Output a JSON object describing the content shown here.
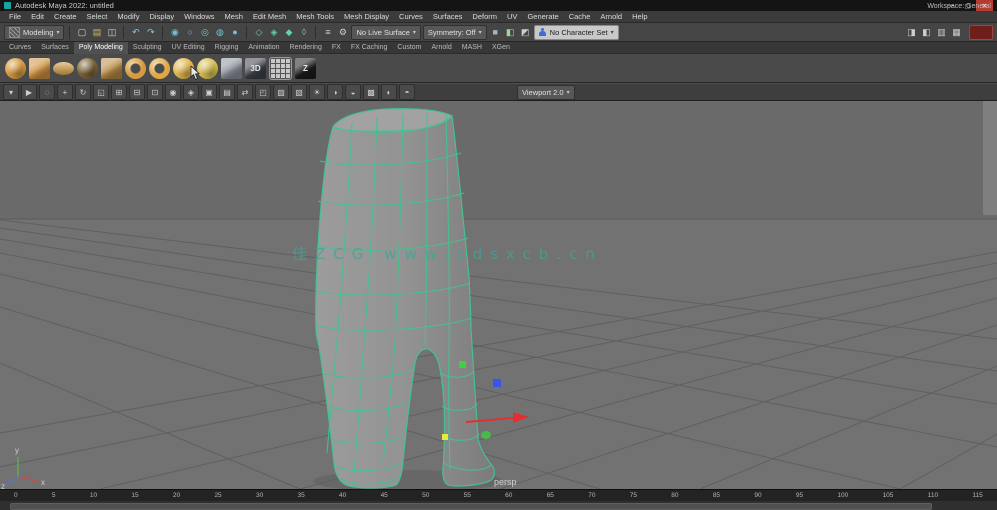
{
  "ui": {
    "caret": "▾"
  },
  "window": {
    "title": "Autodesk Maya 2022: untitled",
    "minimize": "—",
    "maximize": "▢",
    "close": "✕"
  },
  "menubar": {
    "items": [
      "File",
      "Edit",
      "Create",
      "Select",
      "Modify",
      "Display",
      "Windows",
      "Mesh",
      "Edit Mesh",
      "Mesh Tools",
      "Mesh Display",
      "Curves",
      "Surfaces",
      "Deform",
      "UV",
      "Generate",
      "Cache",
      "Arnold",
      "Help"
    ],
    "workspace": "Workspace: General"
  },
  "statusline": {
    "menuset": "Modeling",
    "icons": [
      {
        "type": "sep"
      },
      {
        "name": "new-scene-icon",
        "glyph": "▢",
        "color": "#d8d8d8"
      },
      {
        "name": "open-scene-icon",
        "glyph": "▤",
        "color": "#d8b86a"
      },
      {
        "name": "save-scene-icon",
        "glyph": "◫",
        "color": "#d8d8d8"
      },
      {
        "type": "sep"
      },
      {
        "name": "undo-icon",
        "glyph": "↶",
        "color": "#8fc6e8"
      },
      {
        "name": "redo-icon",
        "glyph": "↷",
        "color": "#8fc6e8"
      },
      {
        "type": "sep"
      },
      {
        "name": "select-hierarchy-icon",
        "glyph": "◉",
        "color": "#6cc6d8"
      },
      {
        "name": "select-object-icon",
        "glyph": "○",
        "color": "#6cc6d8"
      },
      {
        "name": "select-component-icon",
        "glyph": "◎",
        "color": "#6cc6d8"
      },
      {
        "name": "select-highlight-icon",
        "glyph": "◍",
        "color": "#6cc6d8"
      },
      {
        "name": "select-preset-icon",
        "glyph": "●",
        "color": "#6cc6d8"
      },
      {
        "type": "sep"
      },
      {
        "name": "snap-grid-icon",
        "glyph": "◇",
        "color": "#63d0b0"
      },
      {
        "name": "snap-curve-icon",
        "glyph": "◈",
        "color": "#63d0b0"
      },
      {
        "name": "snap-point-icon",
        "glyph": "◆",
        "color": "#63d0b0"
      },
      {
        "name": "snap-plane-icon",
        "glyph": "◊",
        "color": "#63d0b0"
      },
      {
        "type": "sep"
      },
      {
        "name": "history-icon",
        "glyph": "≡",
        "color": "#cfcfcf"
      },
      {
        "name": "construction-history-icon",
        "glyph": "⚙",
        "color": "#cfcfcf"
      }
    ],
    "live_surface": "No Live Surface",
    "symmetry": "Symmetry: Off",
    "render_icons": [
      {
        "name": "render-frame-icon",
        "glyph": "■",
        "color": "#9fb6c4"
      },
      {
        "name": "ipr-render-icon",
        "glyph": "◧",
        "color": "#9fd49f"
      },
      {
        "name": "render-settings-icon",
        "glyph": "◩",
        "color": "#cfcfcf"
      }
    ],
    "character_set": "No Character Set",
    "right_icons": [
      {
        "name": "attribute-editor-toggle-icon",
        "glyph": "◨",
        "color": "#cfcfcf"
      },
      {
        "name": "tool-settings-toggle-icon",
        "glyph": "◧",
        "color": "#cfcfcf"
      },
      {
        "name": "channel-box-toggle-icon",
        "glyph": "▥",
        "color": "#cfcfcf"
      },
      {
        "name": "modeling-toolkit-toggle-icon",
        "glyph": "▦",
        "color": "#cfcfcf"
      }
    ]
  },
  "shelf": {
    "tabs": [
      "Curves",
      "Surfaces",
      "Poly Modeling",
      "Sculpting",
      "UV Editing",
      "Rigging",
      "Animation",
      "Rendering",
      "FX",
      "FX Caching",
      "Custom",
      "Arnold",
      "MASH",
      "XGen"
    ],
    "tools": [
      {
        "name": "poly-sphere-tool",
        "shape": "ball",
        "color": "#d79a3c"
      },
      {
        "name": "poly-cube-tool",
        "shape": "cube",
        "color": "#cd9140"
      },
      {
        "name": "poly-cylinder-tool",
        "shape": "coin",
        "color": "#d79a3c"
      },
      {
        "name": "poly-cone-tool",
        "shape": "ball",
        "color": "#7a6238"
      },
      {
        "name": "poly-plane-tool",
        "shape": "cube",
        "color": "#b58a45"
      },
      {
        "name": "poly-torus-tool",
        "shape": "ring",
        "color": "#d79a3c"
      },
      {
        "name": "poly-disc-tool",
        "shape": "ring",
        "color": "#e0a844"
      },
      {
        "name": "platonic-solid-tool",
        "shape": "ball",
        "color": "#e3b84e"
      },
      {
        "name": "super-shape-tool",
        "shape": "ball",
        "color": "#d8c050"
      },
      {
        "name": "sculpt-mesh-tool",
        "shape": "cube",
        "color": "#8a8f9a"
      },
      {
        "name": "type-3d-tool",
        "shape": "cube",
        "color": "#3c4148",
        "label": "3D"
      },
      {
        "name": "table-grid-tool",
        "shape": "grid",
        "color": "#c8c8c8"
      },
      {
        "name": "sketch-tool",
        "shape": "cube",
        "color": "#1b1b1d",
        "label": "Z"
      }
    ]
  },
  "panel_toolbar": {
    "icons": [
      {
        "name": "panel-menu-caret-icon",
        "glyph": "▾"
      },
      {
        "name": "select-tool-icon",
        "glyph": "▶"
      },
      {
        "name": "lasso-tool-icon",
        "glyph": "◌"
      },
      {
        "name": "move-tool-icon",
        "glyph": "+"
      },
      {
        "name": "rotate-tool-icon",
        "glyph": "↻"
      },
      {
        "name": "scale-tool-icon",
        "glyph": "◱"
      },
      {
        "name": "snap-grid-toggle-icon",
        "glyph": "⊞"
      },
      {
        "name": "snap-curve-toggle-icon",
        "glyph": "⊟"
      },
      {
        "name": "snap-point-toggle-icon",
        "glyph": "⊡"
      },
      {
        "name": "camera-select-icon",
        "glyph": "◉"
      },
      {
        "name": "camera-lock-icon",
        "glyph": "◈"
      },
      {
        "name": "bookmark-icon",
        "glyph": "▣"
      },
      {
        "name": "image-plane-icon",
        "glyph": "▤"
      },
      {
        "name": "pan-zoom-icon",
        "glyph": "⇄"
      },
      {
        "name": "isolate-select-icon",
        "glyph": "◰"
      },
      {
        "name": "xray-icon",
        "glyph": "▨"
      },
      {
        "name": "wireframe-on-shaded-icon",
        "glyph": "▧"
      },
      {
        "name": "default-lighting-icon",
        "glyph": "☀"
      },
      {
        "name": "shadows-icon",
        "glyph": "◑"
      },
      {
        "name": "ambient-occlusion-icon",
        "glyph": "◒"
      },
      {
        "name": "antialiasing-icon",
        "glyph": "▩"
      },
      {
        "name": "depth-of-field-icon",
        "glyph": "◐"
      },
      {
        "name": "motion-blur-icon",
        "glyph": "◓"
      }
    ],
    "renderer": "Viewport 2.0"
  },
  "viewport": {
    "camera": "persp",
    "watermark": "佳ZCG www.cdsxcb.cn",
    "axis_x": "x",
    "axis_y": "y",
    "axis_z": "z"
  },
  "timeline": {
    "ticks": [
      "0",
      "5",
      "10",
      "15",
      "20",
      "25",
      "30",
      "35",
      "40",
      "45",
      "50",
      "55",
      "60",
      "65",
      "70",
      "75",
      "80",
      "85",
      "90",
      "95",
      "100",
      "105",
      "110",
      "115"
    ]
  },
  "colors": {
    "selection_green": "#46c190",
    "manip_red": "#e03030",
    "manip_green": "#3fd23f",
    "manip_green2": "#4ab84c",
    "manip_blue": "#3a56e8",
    "manip_yellow": "#e8e83a"
  }
}
